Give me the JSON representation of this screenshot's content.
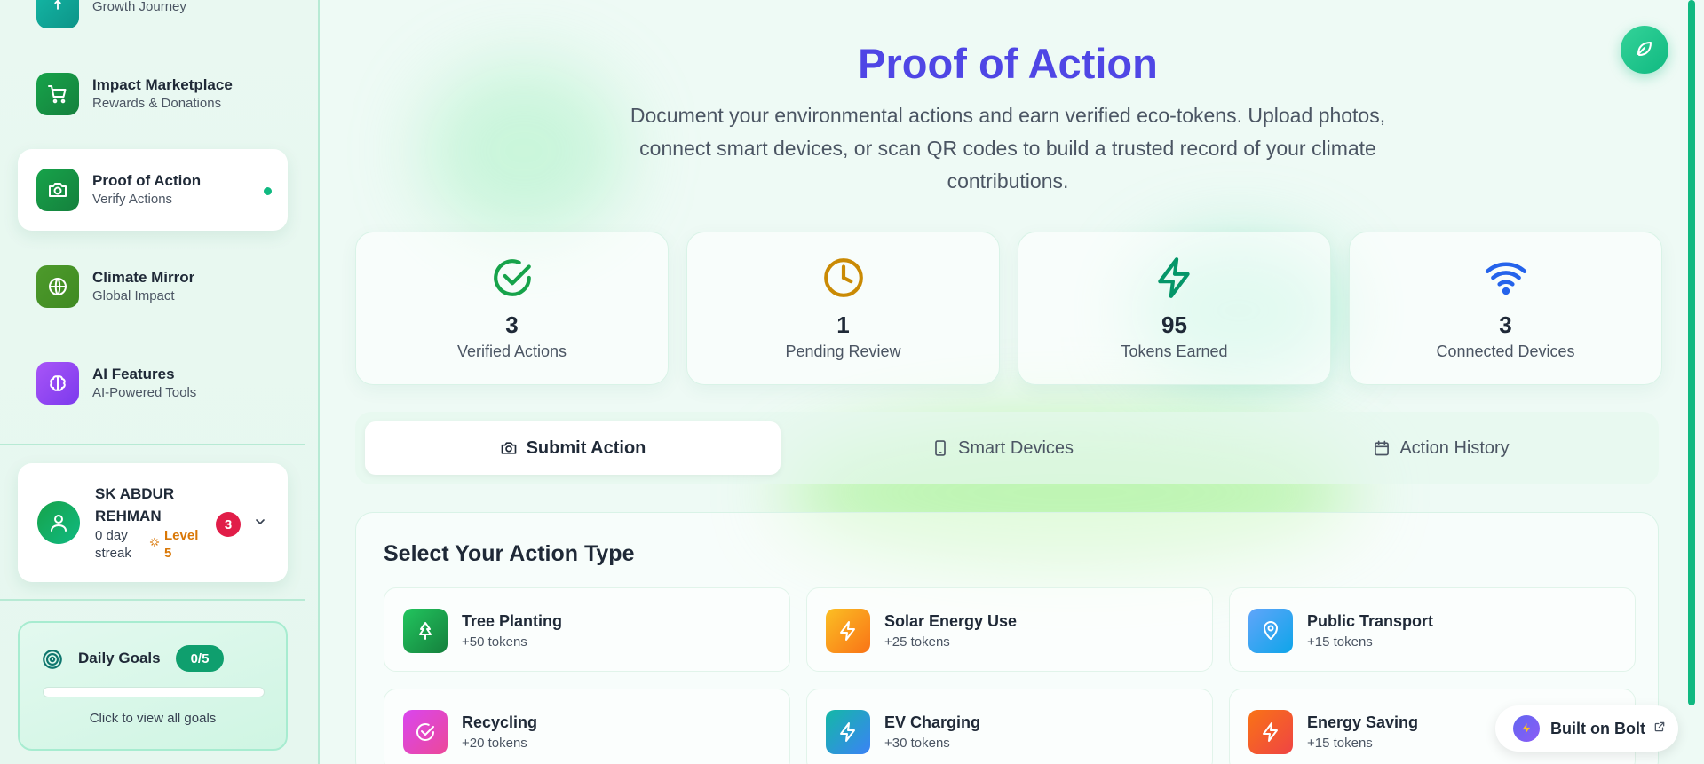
{
  "sidebar": {
    "items": [
      {
        "label": "",
        "sub": "Growth Journey",
        "icon": "trophy-icon",
        "color": "#14b8a6"
      },
      {
        "label": "Impact Marketplace",
        "sub": "Rewards & Donations",
        "icon": "cart-icon",
        "color": "#15803d"
      },
      {
        "label": "Proof of Action",
        "sub": "Verify Actions",
        "icon": "camera-icon",
        "color": "#15803d",
        "active": true
      },
      {
        "label": "Climate Mirror",
        "sub": "Global Impact",
        "icon": "globe-icon",
        "color": "#4d9a2b"
      },
      {
        "label": "AI Features",
        "sub": "AI-Powered Tools",
        "icon": "brain-icon",
        "color": "#8b5cf6"
      }
    ],
    "user": {
      "name": "SK ABDUR REHMAN",
      "streak": "0 day streak",
      "level": "Level 5",
      "notifications": "3"
    },
    "goals": {
      "title": "Daily Goals",
      "badge": "0/5",
      "progress": 0,
      "hint": "Click to view all goals"
    }
  },
  "header": {
    "title": "Proof of Action",
    "description": "Document your environmental actions and earn verified eco-tokens. Upload photos, connect smart devices, or scan QR codes to build a trusted record of your climate contributions."
  },
  "stats": [
    {
      "value": "3",
      "label": "Verified Actions",
      "icon": "check-circle-icon",
      "color": "#16a34a"
    },
    {
      "value": "1",
      "label": "Pending Review",
      "icon": "clock-icon",
      "color": "#ca8a04"
    },
    {
      "value": "95",
      "label": "Tokens Earned",
      "icon": "zap-icon",
      "color": "#059669"
    },
    {
      "value": "3",
      "label": "Connected Devices",
      "icon": "wifi-icon",
      "color": "#2563eb"
    }
  ],
  "tabs": [
    {
      "label": "Submit Action",
      "icon": "camera-icon",
      "active": true
    },
    {
      "label": "Smart Devices",
      "icon": "smartphone-icon"
    },
    {
      "label": "Action History",
      "icon": "calendar-icon"
    }
  ],
  "actions": {
    "title": "Select Your Action Type",
    "items": [
      {
        "name": "Tree Planting",
        "tokens": "+50 tokens",
        "icon": "tree-icon",
        "color": "#16a34a"
      },
      {
        "name": "Solar Energy Use",
        "tokens": "+25 tokens",
        "icon": "zap-icon",
        "color": "#f59e0b"
      },
      {
        "name": "Public Transport",
        "tokens": "+15 tokens",
        "icon": "map-pin-icon",
        "color": "#3b82f6"
      },
      {
        "name": "Recycling",
        "tokens": "+20 tokens",
        "icon": "check-circle-icon",
        "color": "#c026d3"
      },
      {
        "name": "EV Charging",
        "tokens": "+30 tokens",
        "icon": "zap-icon",
        "color": "#14b8a6"
      },
      {
        "name": "Energy Saving",
        "tokens": "+15 tokens",
        "icon": "zap-icon",
        "color": "#f97316"
      }
    ]
  },
  "footer": {
    "bolt_label": "Built on Bolt"
  }
}
